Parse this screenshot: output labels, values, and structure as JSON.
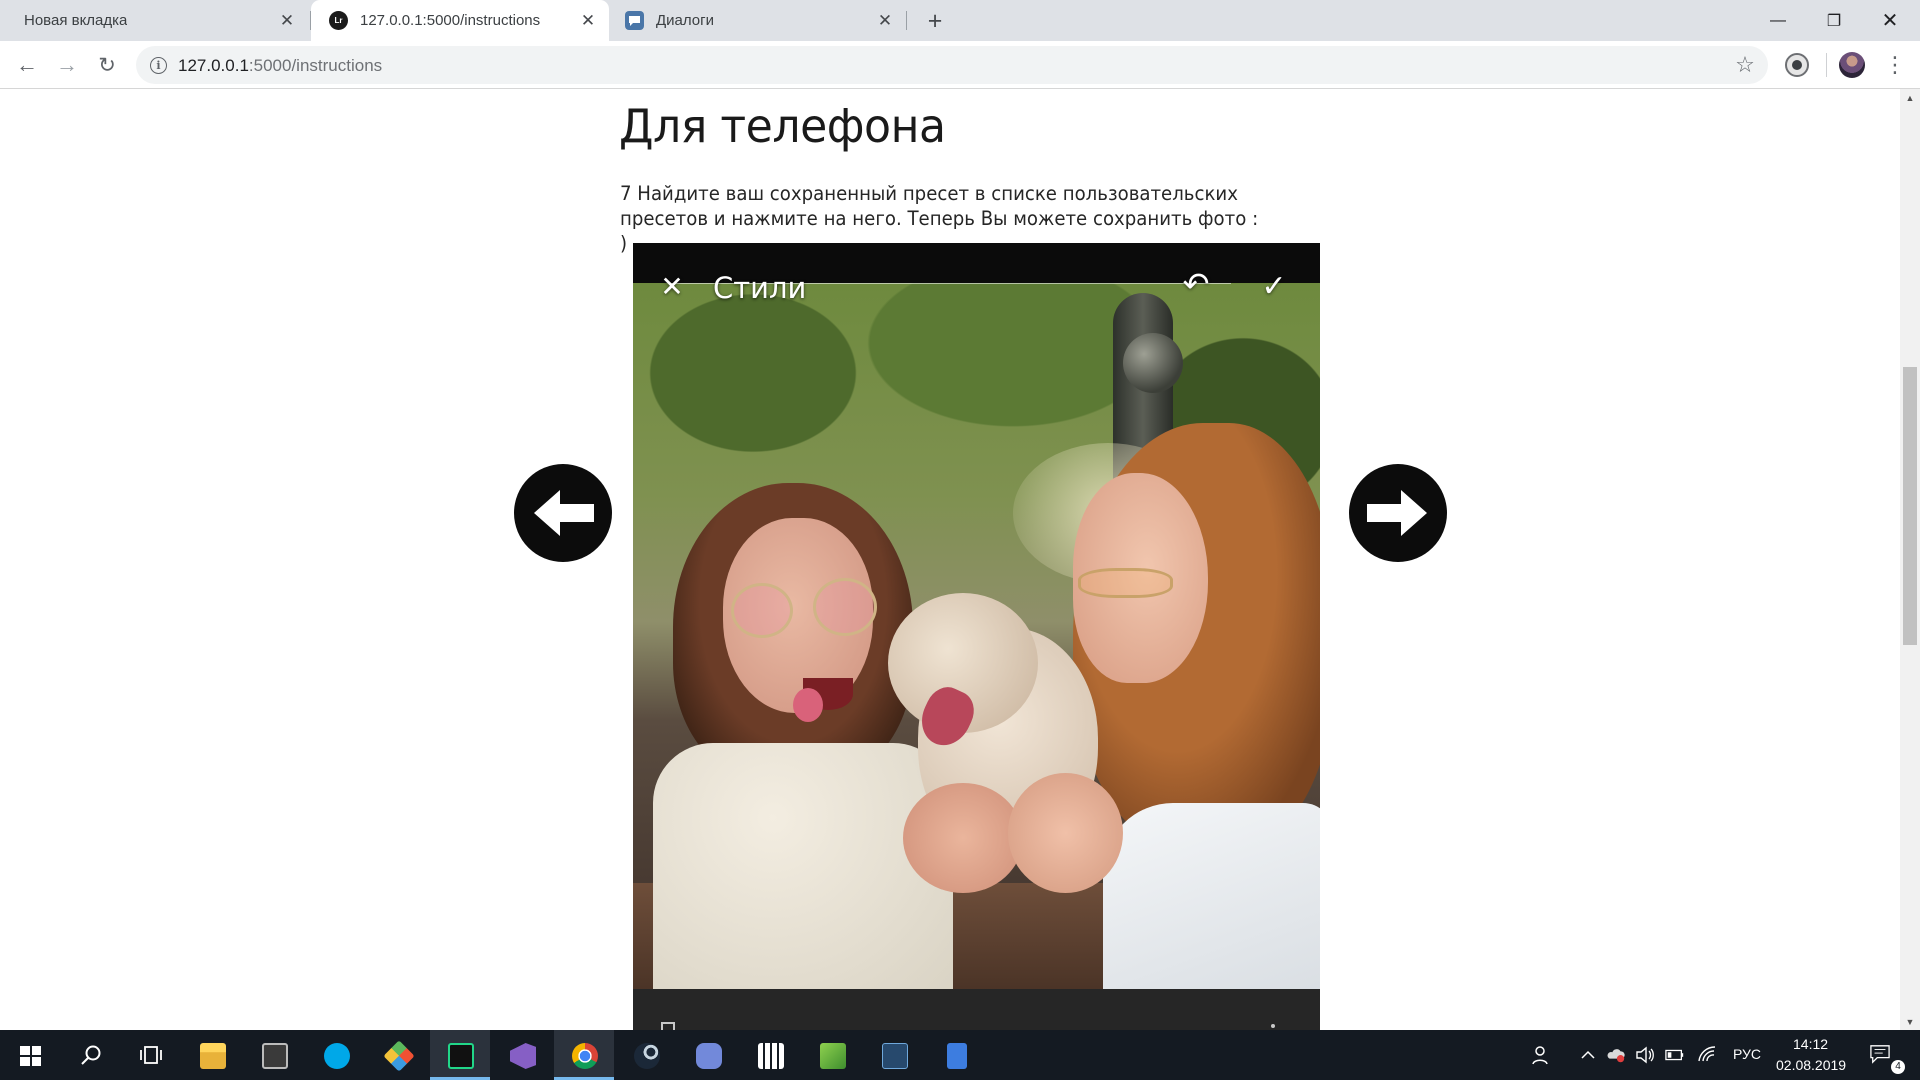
{
  "browser": {
    "tabs": [
      {
        "title": "Новая вкладка",
        "close": "✕"
      },
      {
        "title": "127.0.0.1:5000/instructions",
        "close": "✕",
        "favicon_text": "Lr"
      },
      {
        "title": "Диалоги",
        "close": "✕"
      }
    ],
    "new_tab": "+",
    "window_controls": {
      "minimize": "—",
      "maximize": "❐",
      "close": "✕"
    },
    "toolbar": {
      "back": "←",
      "forward": "→",
      "reload": "↻",
      "info": "i",
      "url_host": "127.0.0.1",
      "url_path": ":5000/instructions",
      "bookmark": "☆",
      "menu": "⋮"
    }
  },
  "page": {
    "heading": "Для телефона",
    "instruction": "7 Найдите ваш сохраненный пресет в списке пользовательских пресетов и нажмите на него. Теперь Вы можете сохранить фото : )",
    "app_screenshot": {
      "title": "Стили",
      "close_icon": "✕",
      "undo_icon": "↶",
      "check_icon": "✓"
    },
    "nav": {
      "prev": "previous-arrow",
      "next": "next-arrow"
    }
  },
  "scrollbar": {
    "up": "▲",
    "down": "▼"
  },
  "taskbar": {
    "apps": [
      "start",
      "search",
      "task-view",
      "file-explorer",
      "notion",
      "skype",
      "git",
      "pycharm",
      "visual-studio",
      "chrome",
      "steam",
      "discord",
      "calculator",
      "notepad-plus-plus",
      "app-icon",
      "docs"
    ],
    "active_app": "chrome",
    "language": "РУС",
    "time": "14:12",
    "date": "02.08.2019",
    "notifications": "4"
  },
  "colors": {
    "tab_strip": "#dee1e6",
    "taskbar": "#141a22",
    "accent_underline": "#76b9ed",
    "arrow_button": "#0c0c0c"
  }
}
